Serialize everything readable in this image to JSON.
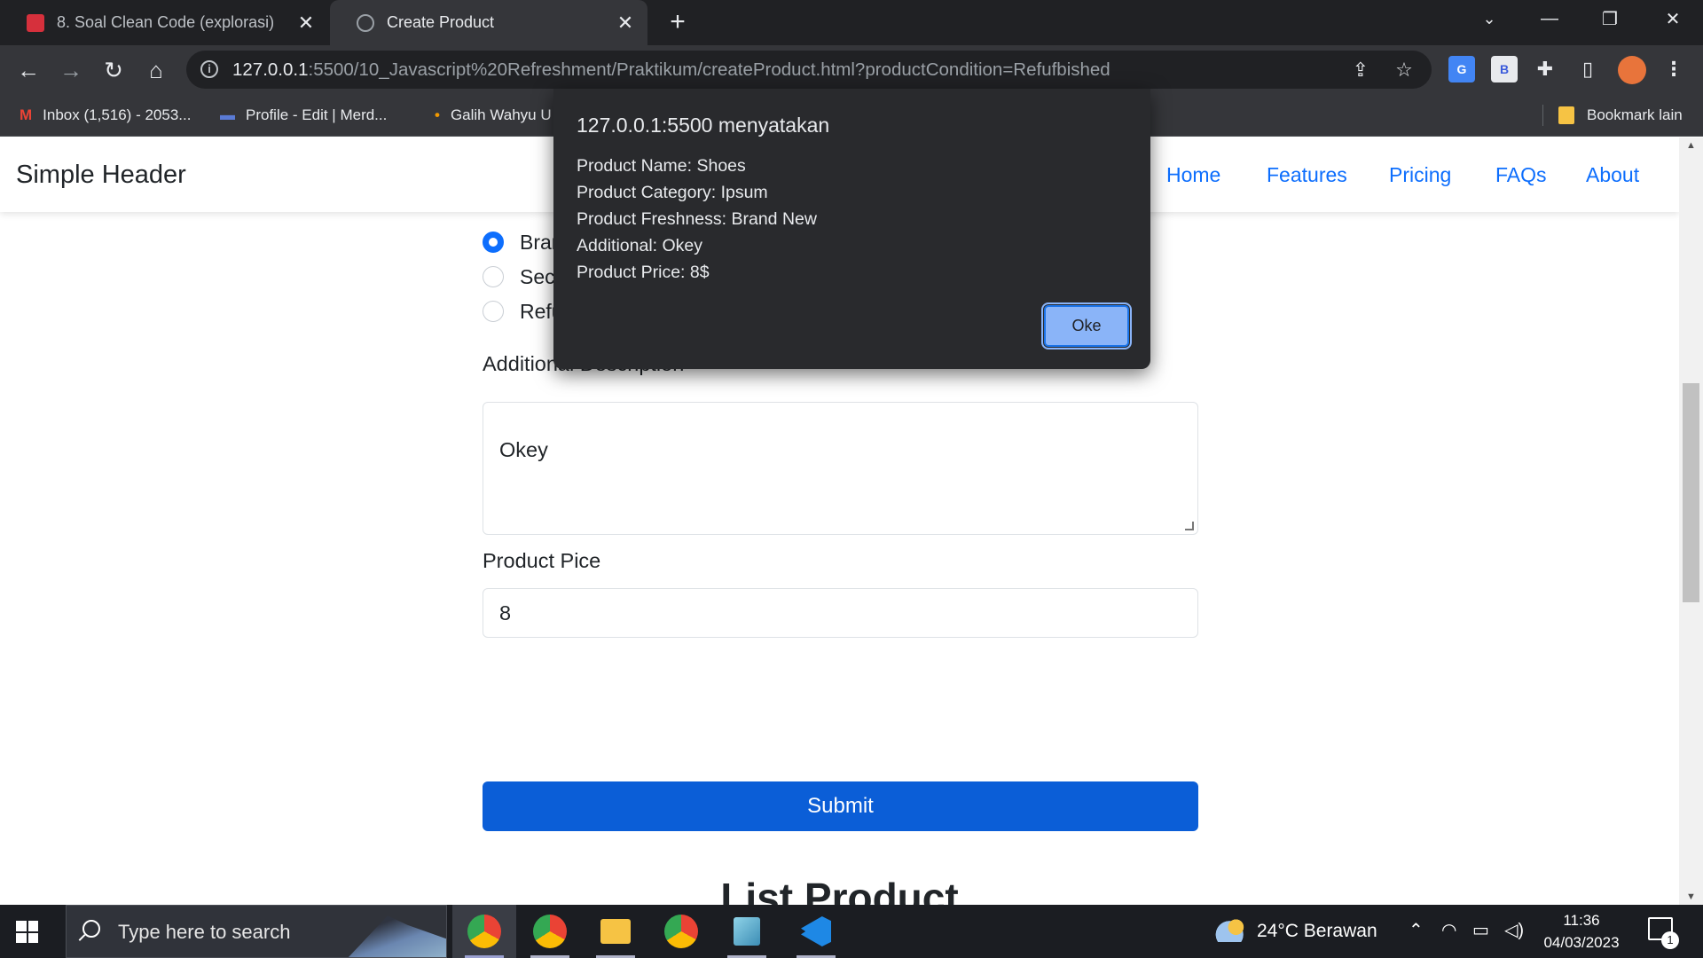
{
  "browser": {
    "tabs": [
      {
        "title": "8. Soal Clean Code (explorasi)",
        "close": "✕",
        "favicon": "book-icon"
      },
      {
        "title": "Create Product",
        "close": "✕",
        "favicon": "globe-icon"
      }
    ],
    "new_tab": "+",
    "window_controls": {
      "dropdown": "⌄",
      "minimize": "—",
      "restore": "❐",
      "close": "✕"
    },
    "nav": {
      "back": "←",
      "forward": "→",
      "reload": "↻",
      "home": "⌂"
    },
    "url": {
      "host": "127.0.0.1",
      "rest": ":5500/10_Javascript%20Refreshment/Praktikum/createProduct.html?productCondition=Refufbished"
    },
    "omnibox_icons": {
      "info": "i",
      "share": "⇪",
      "star": "☆"
    },
    "extensions": {
      "translate": "G",
      "b_ext": "B",
      "puzzle": "✚",
      "sidebar": "▯",
      "menu": "⋮"
    },
    "bookmarks": [
      {
        "icon": "M",
        "label": "Inbox (1,516) - 2053..."
      },
      {
        "icon": "▬",
        "label": "Profile - Edit | Merd..."
      },
      {
        "icon": "•",
        "label": "Galih Wahyu U"
      }
    ],
    "bookmarks_other": "Bookmark lain"
  },
  "site": {
    "brand": "Simple Header",
    "nav": [
      "Home",
      "Features",
      "Pricing",
      "FAQs",
      "About"
    ],
    "radios": [
      {
        "label": "Bran",
        "checked": true
      },
      {
        "label": "Seco",
        "checked": false
      },
      {
        "label": "Refu",
        "checked": false
      }
    ],
    "additional_label": "Additional Description",
    "additional_value": "Okey",
    "price_label": "Product Pice",
    "price_value": "8",
    "submit_label": "Submit",
    "list_heading": "List Product"
  },
  "dialog": {
    "title": "127.0.0.1:5500 menyatakan",
    "lines": [
      "Product Name: Shoes",
      "Product Category: Ipsum",
      "Product Freshness: Brand New",
      "Additional: Okey",
      "Product Price: 8$"
    ],
    "ok_label": "Oke"
  },
  "taskbar": {
    "search_placeholder": "Type here to search",
    "weather": "24°C  Berawan",
    "time": "11:36",
    "date": "04/03/2023",
    "notifications": "1",
    "tray": {
      "chevron": "⌃",
      "wifi": "◠",
      "battery": "▭",
      "volume": "◁)"
    }
  },
  "colors": {
    "accent": "#0d6efd",
    "submit": "#0b5ed7",
    "dialog_bg": "#292a2d",
    "ok_button": "#8ab4f8"
  }
}
